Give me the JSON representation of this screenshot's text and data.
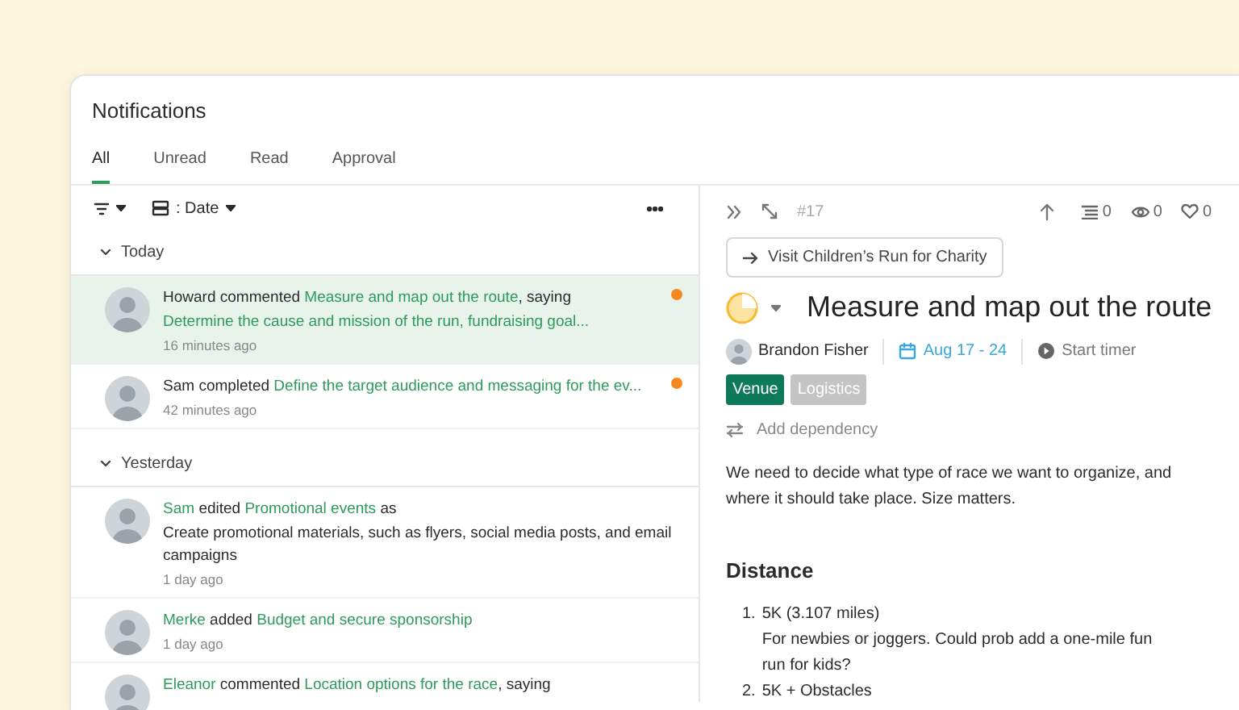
{
  "window": {
    "title": "Notifications"
  },
  "tabs": [
    {
      "label": "All",
      "selected": true
    },
    {
      "label": "Unread",
      "selected": false
    },
    {
      "label": "Read",
      "selected": false
    },
    {
      "label": "Approval",
      "selected": false
    }
  ],
  "toolbar": {
    "group_label": ": Date"
  },
  "sections": [
    {
      "title": "Today",
      "expanded": true,
      "items": [
        {
          "segments": [
            {
              "text": "Howard",
              "link": false
            },
            {
              "text": "commented",
              "link": false
            },
            {
              "text": "Measure and map out the route",
              "link": true
            },
            {
              "text": ", saying",
              "link": false
            }
          ],
          "body": {
            "text": "Determine the cause and mission of the run, fundraising goal...",
            "link": true
          },
          "time": "16 minutes ago",
          "unread": true,
          "selected": true
        },
        {
          "segments": [
            {
              "text": "Sam",
              "link": false
            },
            {
              "text": "completed",
              "link": false
            },
            {
              "text": "Define the target audience and messaging for the ev...",
              "link": true
            }
          ],
          "time": "42 minutes ago",
          "unread": true,
          "selected": false
        }
      ]
    },
    {
      "title": "Yesterday",
      "expanded": true,
      "items": [
        {
          "segments": [
            {
              "text": "Sam",
              "link": true
            },
            {
              "text": "edited",
              "link": false
            },
            {
              "text": "Promotional events",
              "link": true
            },
            {
              "text": "as",
              "link": false
            }
          ],
          "body": {
            "text": "Create promotional materials, such as flyers, social media posts, and email campaigns",
            "link": false
          },
          "time": "1 day ago",
          "unread": false,
          "selected": false
        },
        {
          "segments": [
            {
              "text": "Merke",
              "link": true
            },
            {
              "text": "added",
              "link": false
            },
            {
              "text": "Budget and secure sponsorship",
              "link": true
            }
          ],
          "time": "1 day ago",
          "unread": false,
          "selected": false
        },
        {
          "segments": [
            {
              "text": "Eleanor",
              "link": true
            },
            {
              "text": "commented",
              "link": false
            },
            {
              "text": "Location options for the race",
              "link": true
            },
            {
              "text": ", saying",
              "link": false
            }
          ],
          "unread": false,
          "selected": false
        }
      ]
    }
  ],
  "task": {
    "number": "#17",
    "subtasks": "0",
    "watchers": "0",
    "likes": "0",
    "parent_button": "Visit Children’s Run for Charity",
    "status": {
      "kind": "in_progress"
    },
    "title": "Measure and map out the route",
    "assignee": "Brandon Fisher",
    "dates": "Aug 17 - 24",
    "timer": "Start timer",
    "tags": [
      {
        "label": "Venue",
        "color": "#0f7a5a"
      },
      {
        "label": "Logistics",
        "color": "#c4c4c4"
      }
    ],
    "dependency": "Add dependency",
    "description": "We need to decide what type of race we want to organize, and where it should take place. Size matters.",
    "heading": "Distance",
    "list": [
      {
        "marker": "1.",
        "title": "5K (3.107 miles)",
        "note": "For newbies or joggers. Could prob add a one-mile fun run for kids?"
      },
      {
        "marker": "2.",
        "title": "5K + Obstacles"
      }
    ]
  }
}
